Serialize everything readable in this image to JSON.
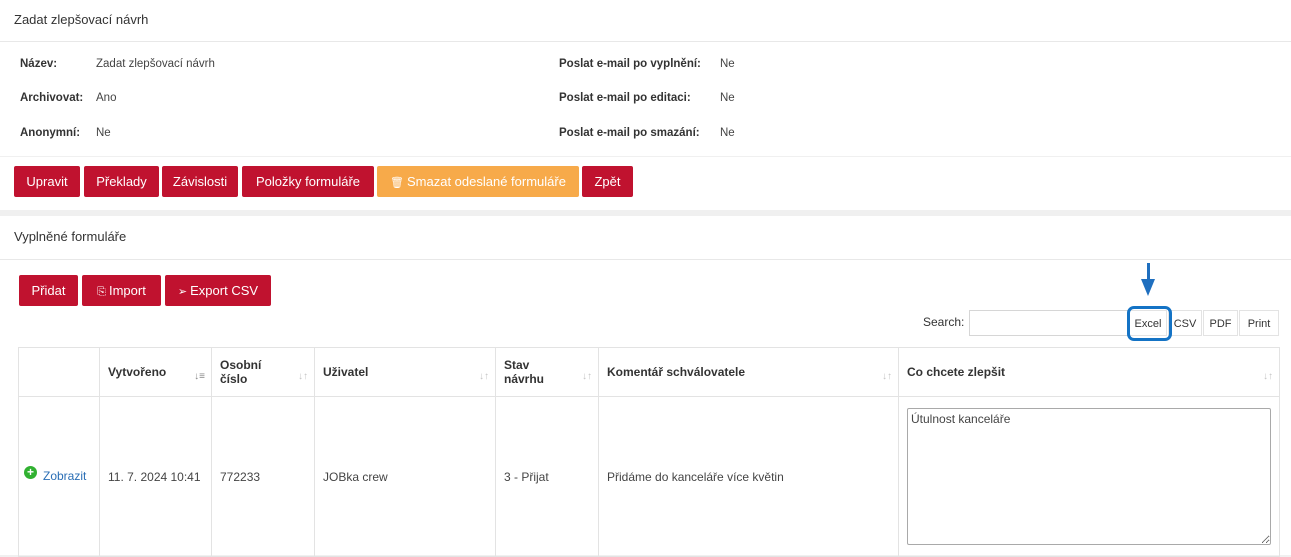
{
  "info": {
    "title": "Zadat zlepšovací návrh",
    "fields": {
      "nazev_label": "Název:",
      "nazev_value": "Zadat zlepšovací návrh",
      "archivovat_label": "Archivovat:",
      "archivovat_value": "Ano",
      "anonymni_label": "Anonymní:",
      "anonymni_value": "Ne",
      "email_vyplneni_label": "Poslat e-mail po vyplnění:",
      "email_vyplneni_value": "Ne",
      "email_editaci_label": "Poslat e-mail po editaci:",
      "email_editaci_value": "Ne",
      "email_smazani_label": "Poslat e-mail po smazání:",
      "email_smazani_value": "Ne"
    }
  },
  "actions": {
    "upravit": "Upravit",
    "preklady": "Překlady",
    "zavislosti": "Závislosti",
    "polozky": "Položky formuláře",
    "smazat": "Smazat odeslané formuláře",
    "zpet": "Zpět"
  },
  "filled": {
    "title": "Vyplněné formuláře",
    "pridat": "Přidat",
    "import": "Import",
    "export_csv": "Export CSV",
    "search_label": "Search:",
    "search_value": "",
    "export_buttons": {
      "excel": "Excel",
      "csv": "CSV",
      "pdf": "PDF",
      "print": "Print"
    },
    "columns": {
      "vytvoreno": "Vytvořeno",
      "osobni_1": "Osobní",
      "osobni_2": "číslo",
      "uzivatel": "Uživatel",
      "stav_1": "Stav",
      "stav_2": "návrhu",
      "komentar": "Komentář schválovatele",
      "zlepsit": "Co chcete zlepšit"
    },
    "rows": [
      {
        "action": "Zobrazit",
        "vytvoreno": "11. 7. 2024 10:41",
        "osobni_cislo": "772233",
        "uzivatel": "JOBka crew",
        "stav": "3 - Přijat",
        "komentar": "Přidáme do kanceláře více květin",
        "zlepsit": "Útulnost kanceláře"
      }
    ]
  },
  "icons": {
    "trash": "trash-icon",
    "import": "file-import-icon",
    "export": "file-export-icon",
    "expand": "plus-circle-icon",
    "sort": "sort-icon",
    "pointer": "arrow-down-icon"
  },
  "colors": {
    "primary_button": "#c0122f",
    "warning_button": "#f7aa4a",
    "link": "#2a6eb5",
    "highlight": "#1473c5",
    "expand_icon": "#31b131"
  }
}
